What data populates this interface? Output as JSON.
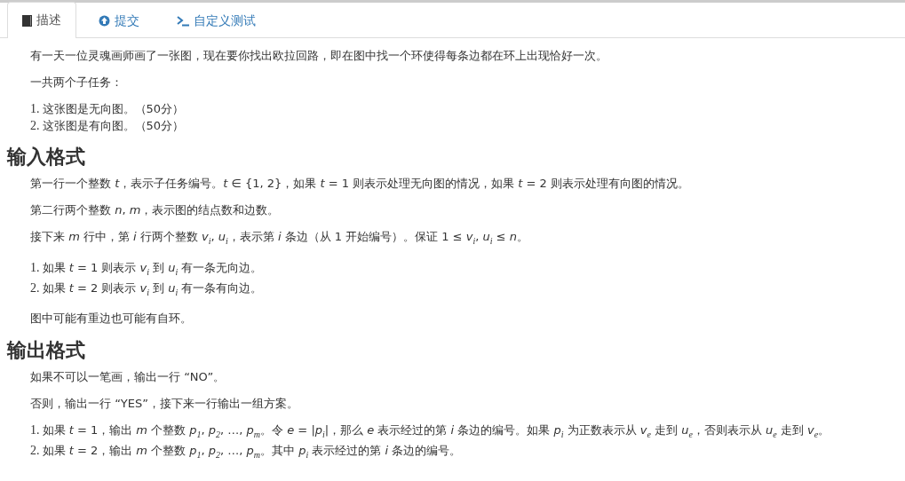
{
  "tabs": [
    {
      "label": "描述",
      "selected": true
    },
    {
      "label": "提交",
      "selected": false
    },
    {
      "label": "自定义测试",
      "selected": false
    }
  ],
  "content": [
    {
      "kind": "p",
      "text": "有一天一位灵魂画师画了一张图，现在要你找出欧拉回路，即在图中找一个环使得每条边都在环上出现恰好一次。"
    },
    {
      "kind": "p",
      "text": "一共两个子任务："
    },
    {
      "kind": "ol",
      "items": [
        {
          "number": "1.",
          "text": "这张图是无向图。（50分）"
        },
        {
          "number": "2.",
          "text": "这张图是有向图。（50分）"
        }
      ]
    },
    {
      "kind": "h",
      "text": "输入格式"
    },
    {
      "kind": "p",
      "text": "第一行一个整数 *t*，表示子任务编号。*t* ∈ {1, 2}，如果 *t* = 1 则表示处理无向图的情况，如果 *t* = 2 则表示处理有向图的情况。"
    },
    {
      "kind": "p",
      "text": "第二行两个整数 *n*, *m*，表示图的结点数和边数。"
    },
    {
      "kind": "p",
      "text": "接下来 *m* 行中，第 *i* 行两个整数 *v*$_{i}$, *u*$_{i}$，表示第 *i* 条边（从 1 开始编号）。保证 1 ≤ *v*$_{i}$, *u*$_{i}$ ≤ *n*。"
    },
    {
      "kind": "ol",
      "items": [
        {
          "number": "1.",
          "text": "如果 *t* = 1 则表示 *v*$_{i}$ 到 *u*$_{i}$ 有一条无向边。"
        },
        {
          "number": "2.",
          "text": "如果 *t* = 2 则表示 *v*$_{i}$ 到 *u*$_{i}$ 有一条有向边。"
        }
      ]
    },
    {
      "kind": "p",
      "text": "图中可能有重边也可能有自环。"
    },
    {
      "kind": "h",
      "text": "输出格式"
    },
    {
      "kind": "p",
      "text": "如果不可以一笔画，输出一行 “NO”。"
    },
    {
      "kind": "p",
      "text": "否则，输出一行 “YES”，接下来一行输出一组方案。"
    },
    {
      "kind": "ol",
      "items": [
        {
          "number": "1.",
          "text": "如果 *t* = 1，输出 *m* 个整数 *p*$_{1}$, *p*$_{2}$, …, *p*$_{m}$。令 *e* = |*p*$_{i}$|，那么 *e* 表示经过的第 *i* 条边的编号。如果 *p*$_{i}$ 为正数表示从 *v*$_{e}$ 走到 *u*$_{e}$，否则表示从 *u*$_{e}$ 走到 *v*$_{e}$。"
        },
        {
          "number": "2.",
          "text": "如果 *t* = 2，输出 *m* 个整数 *p*$_{1}$, *p*$_{2}$, …, *p*$_{m}$。其中 *p*$_{i}$ 表示经过的第 *i* 条边的编号。"
        }
      ]
    }
  ]
}
